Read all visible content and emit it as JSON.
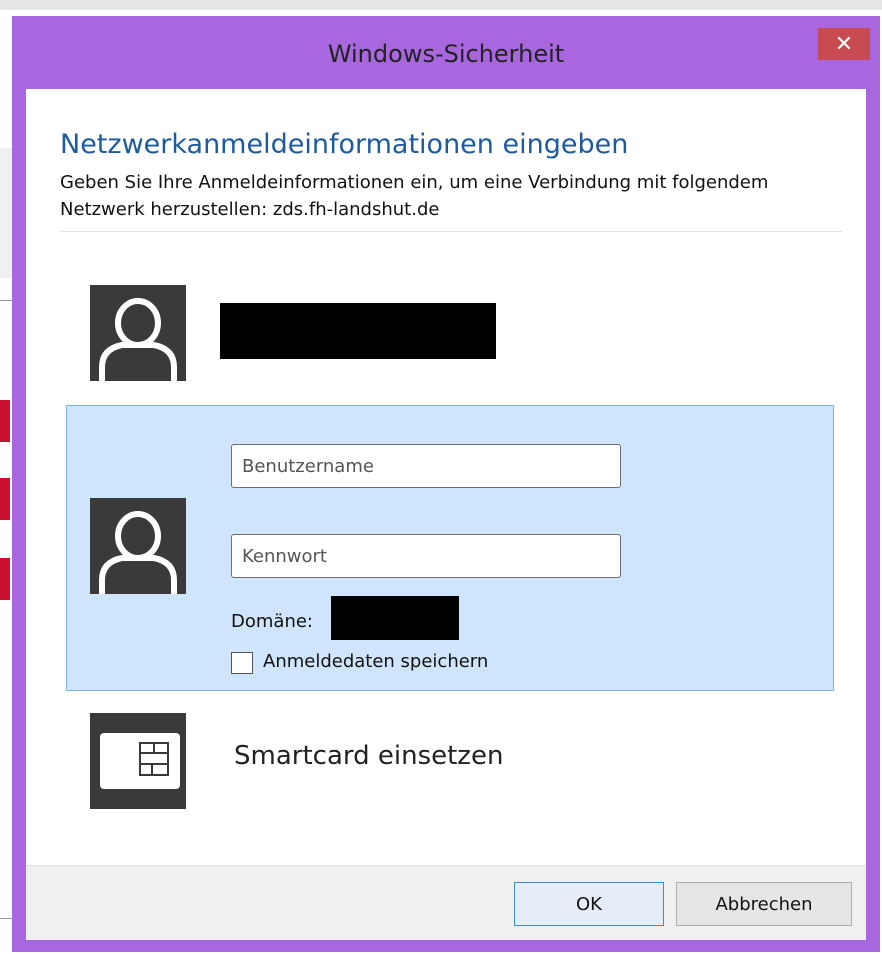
{
  "window": {
    "title": "Windows-Sicherheit",
    "close_glyph": "✕"
  },
  "dialog": {
    "heading": "Netzwerkanmeldeinformationen eingeben",
    "description": "Geben Sie Ihre Anmeldeinformationen ein, um eine Verbindung mit folgendem Netzwerk herzustellen: zds.fh-landshut.de"
  },
  "credentials": {
    "username_placeholder": "Benutzername",
    "password_placeholder": "Kennwort",
    "domain_label": "Domäne:",
    "remember_label": "Anmeldedaten speichern",
    "remember_checked": false
  },
  "smartcard": {
    "label": "Smartcard einsetzen"
  },
  "buttons": {
    "ok": "OK",
    "cancel": "Abbrechen"
  },
  "icons": {
    "user": "user-avatar-icon",
    "smartcard": "smartcard-icon",
    "close": "close-icon"
  },
  "colors": {
    "frame": "#a867de",
    "close_button": "#c74b50",
    "heading": "#1e5b9e",
    "selected_panel": "#cfe5fb",
    "selected_border": "#7fb2e0",
    "avatar": "#3a3a3a"
  }
}
